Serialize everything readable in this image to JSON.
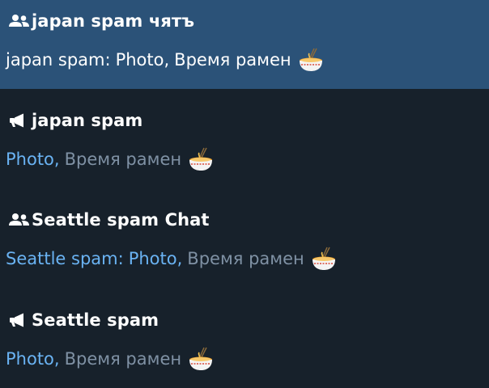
{
  "chats": [
    {
      "title": "japan spam чятъ",
      "type_icon": "group-icon",
      "sender": "japan spam:",
      "media": "Photo,",
      "text": "Время рамен",
      "emoji": "ramen-bowl-icon",
      "active": true
    },
    {
      "title": "japan spam",
      "type_icon": "megaphone-icon",
      "sender": "",
      "media": "Photo,",
      "text": "Время рамен",
      "emoji": "ramen-bowl-icon",
      "active": false
    },
    {
      "title": "Seattle spam Chat",
      "type_icon": "group-icon",
      "sender": "Seattle spam:",
      "media": "Photo,",
      "text": "Время рамен",
      "emoji": "ramen-bowl-icon",
      "active": false
    },
    {
      "title": "Seattle spam",
      "type_icon": "megaphone-icon",
      "sender": "",
      "media": "Photo,",
      "text": "Время рамен",
      "emoji": "ramen-bowl-icon",
      "active": false
    }
  ],
  "colors": {
    "background": "#17212b",
    "active_background": "#2b5278",
    "link_blue": "#6ab3f3",
    "muted_text": "#7f91a4",
    "title_text": "#ffffff"
  }
}
